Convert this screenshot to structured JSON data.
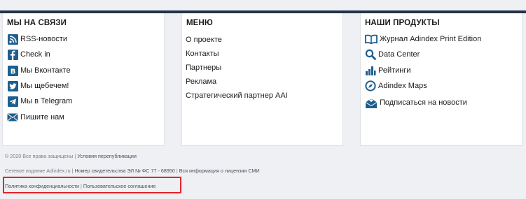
{
  "contacts": {
    "title": "МЫ НА СВЯЗИ",
    "items": [
      {
        "label": "RSS-новости",
        "icon": "rss-icon"
      },
      {
        "label": "Check in",
        "icon": "facebook-icon"
      },
      {
        "label": "Мы Вконтакте",
        "icon": "vk-icon"
      },
      {
        "label": "Мы щебечем!",
        "icon": "twitter-icon"
      },
      {
        "label": "Мы в Telegram",
        "icon": "telegram-icon"
      },
      {
        "label": "Пишите нам",
        "icon": "mail-icon"
      }
    ]
  },
  "menu": {
    "title": "МЕНЮ",
    "items": [
      "О проекте",
      "Контакты",
      "Партнеры",
      "Реклама",
      "Стратегический партнер AAI"
    ]
  },
  "products": {
    "title": "НАШИ ПРОДУКТЫ",
    "items": [
      {
        "label": "Журнал Adindex Print Edition",
        "icon": "book-icon"
      },
      {
        "label": "Data Center",
        "icon": "magnifier-icon"
      },
      {
        "label": "Рейтинги",
        "icon": "bar-chart-icon"
      },
      {
        "label": "Adindex Maps",
        "icon": "compass-icon"
      },
      {
        "label": "Подписаться на новости",
        "icon": "envelope-download-icon"
      }
    ]
  },
  "footer": {
    "copyright": "© 2020 Все права защищены",
    "sep": "|",
    "republish": "Условия перепубликации",
    "media_prefix": "Сетевое издание Adindex.ru",
    "certificate": "Номер свидетельства ЭЛ № ФС 77 - 68950",
    "license": "Вся информация о лицензии СМИ",
    "privacy": "Политика конфиденциальности",
    "agreement": "Пользовательское соглашение"
  },
  "colors": {
    "icon_blue": "#1d5f8f",
    "topbar": "#233347",
    "highlight": "#e8222a"
  }
}
